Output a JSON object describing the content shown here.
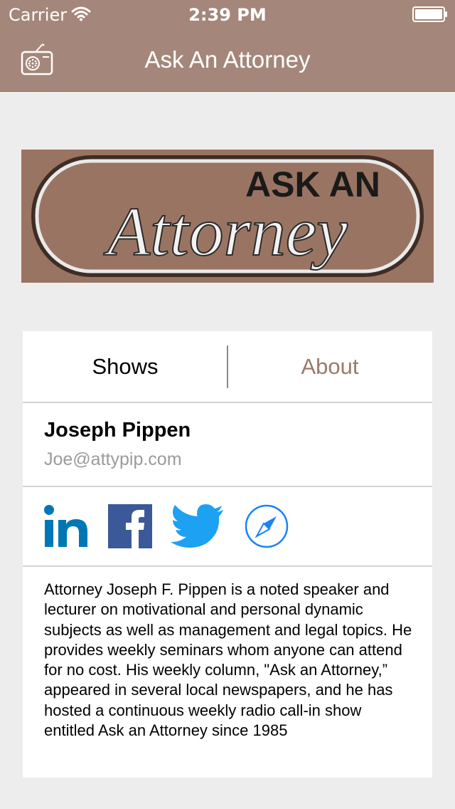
{
  "status_bar": {
    "carrier": "Carrier",
    "time": "2:39 PM",
    "icons": [
      "wifi-icon",
      "battery-icon"
    ]
  },
  "nav_bar": {
    "title": "Ask An Attorney",
    "left_icon": "radio-icon"
  },
  "logo": {
    "line1": "ASK AN",
    "line2": "Attorney"
  },
  "tabs": [
    {
      "label": "Shows",
      "selected": false
    },
    {
      "label": "About",
      "selected": true
    }
  ],
  "contact": {
    "name": "Joseph Pippen",
    "email": "Joe@attypip.com"
  },
  "social": [
    {
      "icon": "linkedin-icon"
    },
    {
      "icon": "facebook-icon"
    },
    {
      "icon": "twitter-icon"
    },
    {
      "icon": "safari-compass-icon"
    }
  ],
  "bio": "Attorney Joseph F. Pippen is a noted speaker and lecturer on motivational and personal dynamic subjects as well as management and legal topics. He provides weekly seminars whom anyone can attend for no cost. His weekly column, \"Ask an Attorney,” appeared in several local newspapers, and he has hosted a continuous weekly radio call-in show entitled Ask an Attorney since 1985",
  "colors": {
    "nav_background": "#a4877a",
    "selected_tab": "#9a7a68",
    "page_background": "#ededed",
    "linkedin": "#0077b5",
    "facebook": "#3b5998",
    "twitter": "#1da1f2",
    "safari": "#1a82f7"
  }
}
